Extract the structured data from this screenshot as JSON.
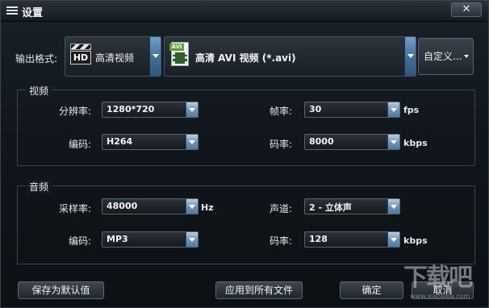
{
  "window": {
    "title": "设置",
    "close_label": "✕"
  },
  "output": {
    "label": "输出格式:",
    "category_value": "高清视频",
    "category_icon": "hd-video-icon",
    "format_value": "高清 AVI 视频 (*.avi)",
    "format_icon": "avi-file-icon",
    "custom_label": "自定义..."
  },
  "video": {
    "group_title": "视频",
    "resolution_label": "分辨率:",
    "resolution_value": "1280*720",
    "encoder_label": "编码:",
    "encoder_value": "H264",
    "framerate_label": "帧率:",
    "framerate_value": "30",
    "framerate_unit": "fps",
    "bitrate_label": "码率:",
    "bitrate_value": "8000",
    "bitrate_unit": "kbps"
  },
  "audio": {
    "group_title": "音频",
    "samplerate_label": "采样率:",
    "samplerate_value": "48000",
    "samplerate_unit": "Hz",
    "encoder_label": "编码:",
    "encoder_value": "MP3",
    "channel_label": "声道:",
    "channel_value": "2 - 立体声",
    "bitrate_label": "码率:",
    "bitrate_value": "128",
    "bitrate_unit": "kbps"
  },
  "buttons": {
    "save_default": "保存为默认值",
    "apply_all": "应用到所有文件",
    "ok": "确定",
    "cancel": "取消"
  },
  "watermark": {
    "text_big": "下载吧",
    "text_small": "www.xiazaiba.com"
  }
}
